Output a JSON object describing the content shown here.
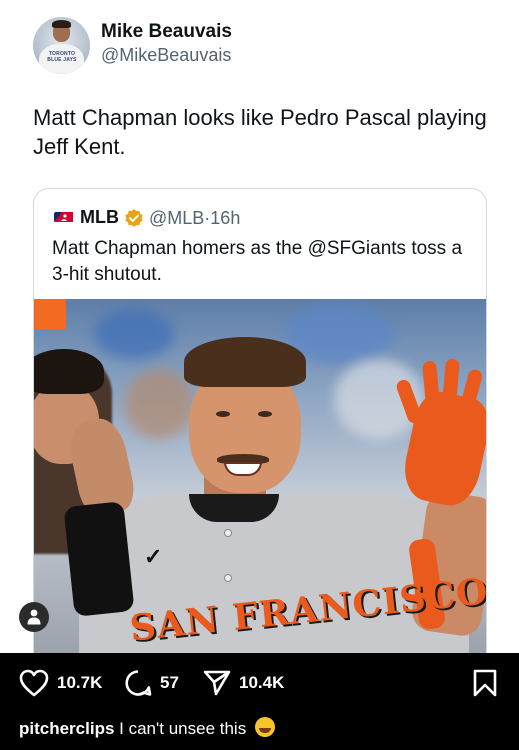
{
  "post": {
    "author": {
      "name": "Mike Beauvais",
      "handle": "@MikeBeauvais",
      "avatar_shirt_text": "TORONTO BLUE JAYS"
    },
    "text": "Matt Chapman looks like Pedro Pascal playing Jeff Kent.",
    "quote": {
      "name": "MLB",
      "handle": "@MLB",
      "separator": "·",
      "time": "16h",
      "text": "Matt Chapman homers as the @SFGiants toss a 3-hit shutout.",
      "photo_jersey_text": "SAN FRANCISCO"
    }
  },
  "actions": {
    "likes": "10.7K",
    "comments": "57",
    "shares": "10.4K"
  },
  "caption": {
    "username": "pitcherclips",
    "text": "I can't unsee this"
  },
  "colors": {
    "text_primary": "#0f1419",
    "text_secondary": "#536471",
    "verified": "#e8a317",
    "giants_orange": "#ea5a1c"
  },
  "icons": {
    "like": "heart-icon",
    "comment": "comment-icon",
    "share": "send-icon",
    "save": "bookmark-icon",
    "verified": "verified-badge-icon",
    "user_tag": "person-icon",
    "mlb": "mlb-logo-icon"
  }
}
